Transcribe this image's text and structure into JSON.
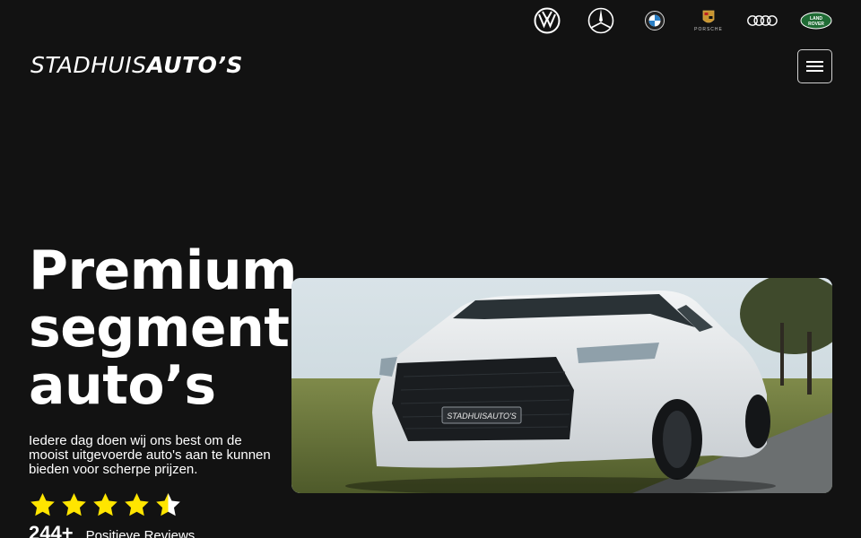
{
  "brands": [
    {
      "name": "volkswagen-logo-icon"
    },
    {
      "name": "mercedes-logo-icon"
    },
    {
      "name": "bmw-logo-icon"
    },
    {
      "name": "porsche-logo-icon",
      "text": "PORSCHE"
    },
    {
      "name": "audi-logo-icon"
    },
    {
      "name": "land-rover-logo-icon",
      "text_top": "LAND",
      "text_bottom": "ROVER"
    }
  ],
  "header": {
    "logo_light": "STADHUIS",
    "logo_bold": "AUTO’S",
    "menu_icon": "hamburger-icon"
  },
  "hero": {
    "title": "Premium\nsegment\nauto’s",
    "subtitle": "Iedere dag doen wij ons best om de mooist uitgevoerde auto's aan te kunnen bieden voor scherpe prijzen.",
    "rating": 4.5,
    "star_color": "#ffe500",
    "reviews_count": "244+",
    "reviews_label": "Positieve Reviews",
    "car_plate": "STADHUISAUTO'S"
  }
}
